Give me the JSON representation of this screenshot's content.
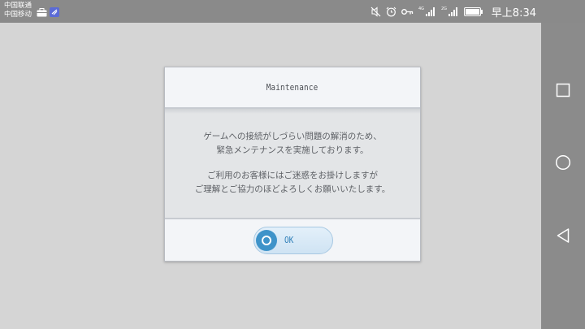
{
  "status_bar": {
    "carrier_1": "中国联通",
    "carrier_2": "中国移动",
    "left_icons": [
      "briefcase-icon",
      "app-badge-icon"
    ],
    "right_icons": [
      "mute-icon",
      "alarm-icon",
      "key-icon",
      "signal-4g-icon",
      "signal-2g-icon",
      "battery-icon"
    ],
    "signal_1_label": "4G",
    "signal_2_label": "2G",
    "time": "早上8:34"
  },
  "dialog": {
    "title": "Maintenance",
    "message_line_1": "ゲームへの接続がしづらい問題の解消のため、",
    "message_line_2": "緊急メンテナンスを実施しております。",
    "message_line_3": "ご利用のお客様にはご迷惑をお掛けしますが",
    "message_line_4": "ご理解とご協力のほどよろしくお願いいたします。",
    "ok_label": "OK"
  },
  "nav_bar": {
    "buttons": [
      "recents-square-icon",
      "home-circle-icon",
      "back-triangle-icon"
    ]
  },
  "colors": {
    "status_bar_bg": "#8a8a8a",
    "game_bg": "#d5d5d5",
    "nav_bar_bg": "#8b8b8b",
    "accent": "#3e93c9"
  }
}
